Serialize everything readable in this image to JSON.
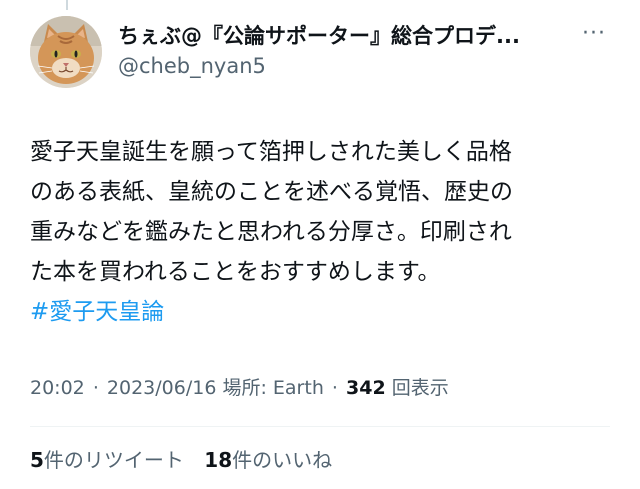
{
  "header": {
    "display_name": "ちぇぶ@『公論サポーター』総合プロデ...",
    "handle": "@cheb_nyan5",
    "more_icon": "more-horizontal-icon",
    "avatar_icon": "cat-avatar"
  },
  "tweet": {
    "lines": [
      "愛子天皇誕生を願って箔押しされた美しく品格",
      "のある表紙、皇統のことを述べる覚悟、歴史の",
      "重みなどを鑑みたと思われる分厚さ。印刷され",
      "た本を買われることをおすすめします。"
    ],
    "hashtag": "#愛子天皇論"
  },
  "meta": {
    "time": "20:02",
    "separator": "·",
    "date": "2023/06/16",
    "location_label": "場所: Earth",
    "views_count": "342",
    "views_label": "回表示"
  },
  "stats": {
    "retweets_count": "5",
    "retweets_label": "件のリツイート",
    "likes_count": "18",
    "likes_label": "件のいいね"
  },
  "colors": {
    "text": "#0f1419",
    "secondary": "#536471",
    "link": "#1d9bf0",
    "divider": "#eff3f4"
  }
}
